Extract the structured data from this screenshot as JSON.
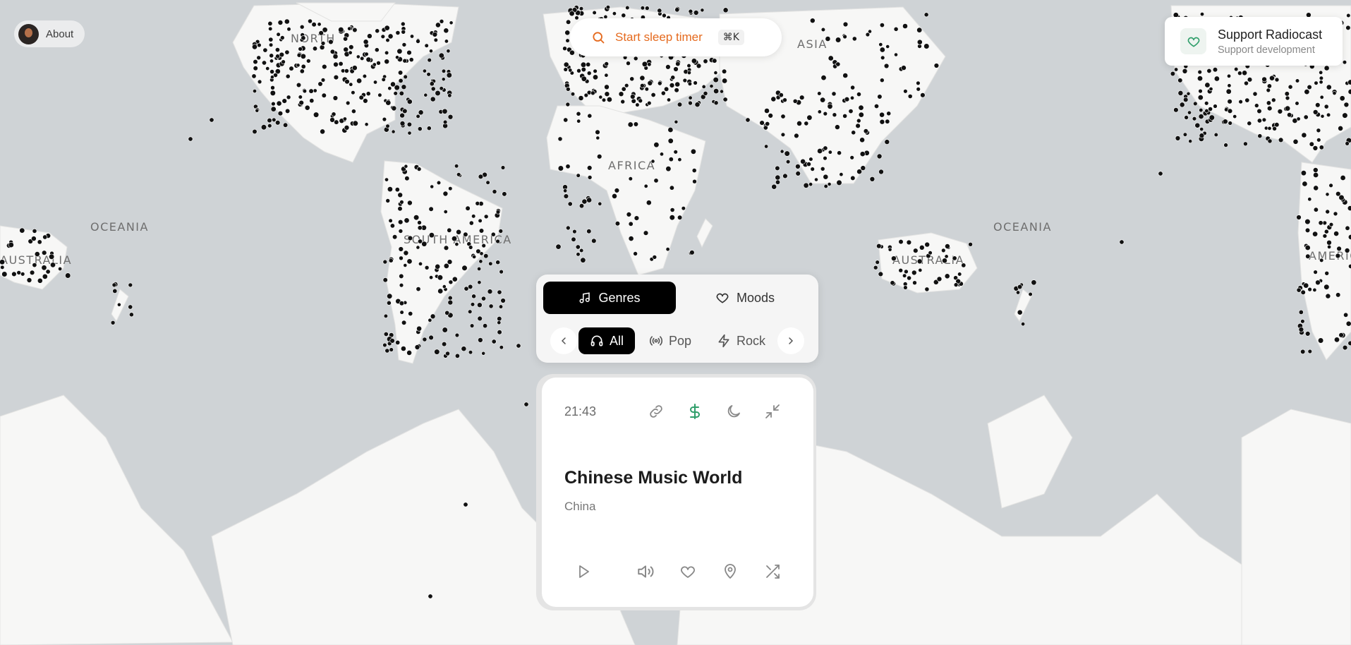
{
  "about": {
    "label": "About"
  },
  "sleep_timer": {
    "label": "Start sleep timer",
    "shortcut": "⌘K",
    "icon": "search-icon"
  },
  "support": {
    "title": "Support Radiocast",
    "subtitle": "Support development",
    "icon": "heart-icon"
  },
  "map": {
    "regions": [
      "NORTH",
      "ASIA",
      "AFRICA",
      "OCEANIA",
      "AUSTRALIA",
      "SOUTH AMERICA",
      "OCEANIA",
      "AUSTRALIA",
      "AMERICA"
    ]
  },
  "panel": {
    "tabs": [
      {
        "label": "Genres",
        "icon": "music-note-icon",
        "active": true
      },
      {
        "label": "Moods",
        "icon": "heart-icon",
        "active": false
      }
    ],
    "chips": [
      {
        "label": "All",
        "icon": "headphones-icon",
        "active": true
      },
      {
        "label": "Pop",
        "icon": "radio-waves-icon",
        "active": false
      },
      {
        "label": "Rock",
        "icon": "lightning-icon",
        "active": false
      }
    ]
  },
  "player": {
    "time": "21:43",
    "station": "Chinese Music World",
    "country": "China",
    "top_icons": [
      "link-icon",
      "dollar-icon",
      "moon-icon",
      "minimize-icon"
    ],
    "controls": [
      "play-icon",
      "volume-icon",
      "heart-icon",
      "location-pin-icon",
      "shuffle-icon"
    ],
    "accent_color": "#2f9e6a"
  }
}
